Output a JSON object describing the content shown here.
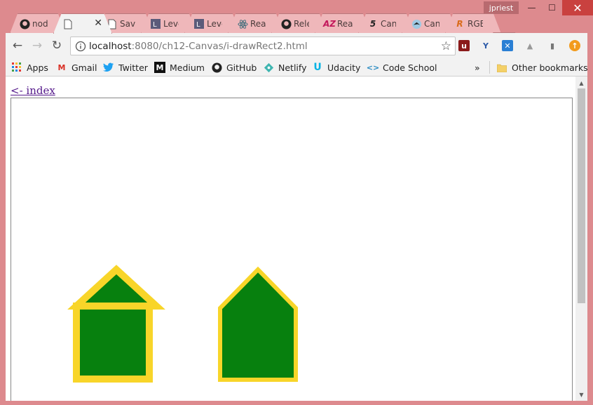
{
  "window": {
    "user": "jpriest",
    "controls": {
      "minimize": "—",
      "maximize": "☐",
      "close": "✕"
    }
  },
  "tabs": [
    {
      "title": "nod",
      "icon": "github-icon"
    },
    {
      "title": "",
      "icon": "page-icon",
      "active": true
    },
    {
      "title": "Save",
      "icon": "page-icon"
    },
    {
      "title": "Leve",
      "icon": "levelup-icon"
    },
    {
      "title": "Leve",
      "icon": "levelup-icon"
    },
    {
      "title": "Rea",
      "icon": "react-icon"
    },
    {
      "title": "Rele",
      "icon": "github-icon"
    },
    {
      "title": "Rea",
      "icon": "az-icon"
    },
    {
      "title": "Can",
      "icon": "html5-icon"
    },
    {
      "title": "Can",
      "icon": "bird-icon"
    },
    {
      "title": "RGB",
      "icon": "r-icon"
    }
  ],
  "toolbar": {
    "url_host": "localhost",
    "url_path": ":8080/ch12-Canvas/i-drawRect2.html"
  },
  "bookmarks": [
    {
      "label": "Apps",
      "icon": "apps-grid-icon"
    },
    {
      "label": "Gmail",
      "icon": "gmail-icon"
    },
    {
      "label": "Twitter",
      "icon": "twitter-icon"
    },
    {
      "label": "Medium",
      "icon": "medium-icon"
    },
    {
      "label": "GitHub",
      "icon": "github-icon"
    },
    {
      "label": "Netlify",
      "icon": "netlify-icon"
    },
    {
      "label": "Udacity",
      "icon": "udacity-icon"
    },
    {
      "label": "Code School",
      "icon": "code-icon"
    }
  ],
  "bookmarks_overflow": "»",
  "other_bookmarks": "Other bookmarks",
  "page": {
    "index_link": "<- index"
  },
  "colors": {
    "house_fill": "#07800e",
    "house_stroke": "#f8d529",
    "canvas_border": "#888888"
  }
}
